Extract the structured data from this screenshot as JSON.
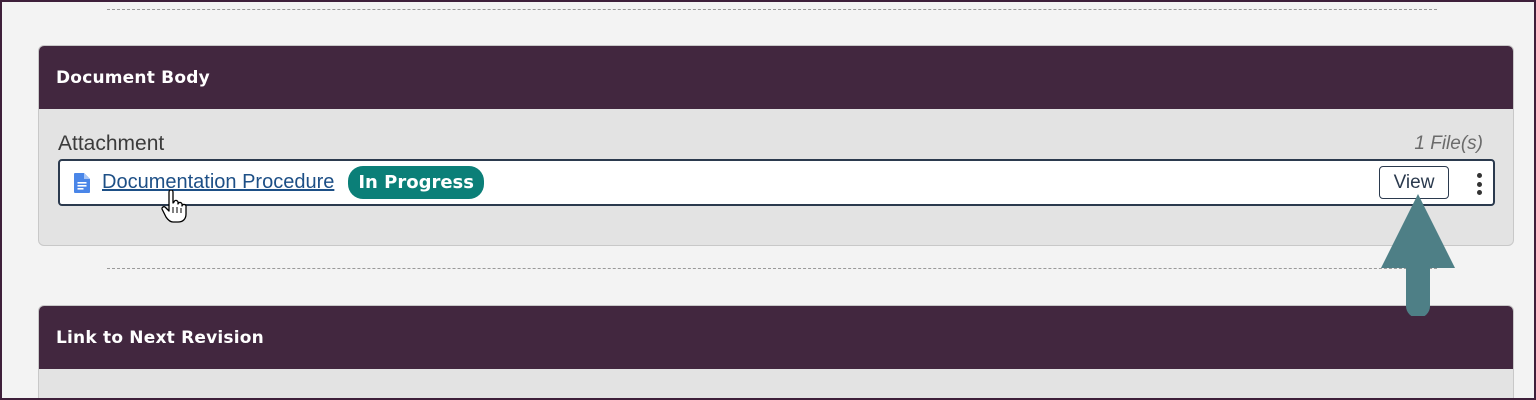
{
  "document_body": {
    "header": "Document Body",
    "attachment_title": "Attachment",
    "file_count": "1 File(s)",
    "file": {
      "name": "Documentation Procedure",
      "status": "In Progress",
      "view_label": "View"
    }
  },
  "next_revision": {
    "header": "Link to Next Revision"
  },
  "colors": {
    "header_bg": "#42273f",
    "badge_bg": "#0b7f78",
    "link": "#1d4f86",
    "arrow": "#4e7f86"
  },
  "icons": [
    "document-icon",
    "kebab-menu-icon",
    "hand-cursor-icon",
    "up-arrow-icon"
  ]
}
